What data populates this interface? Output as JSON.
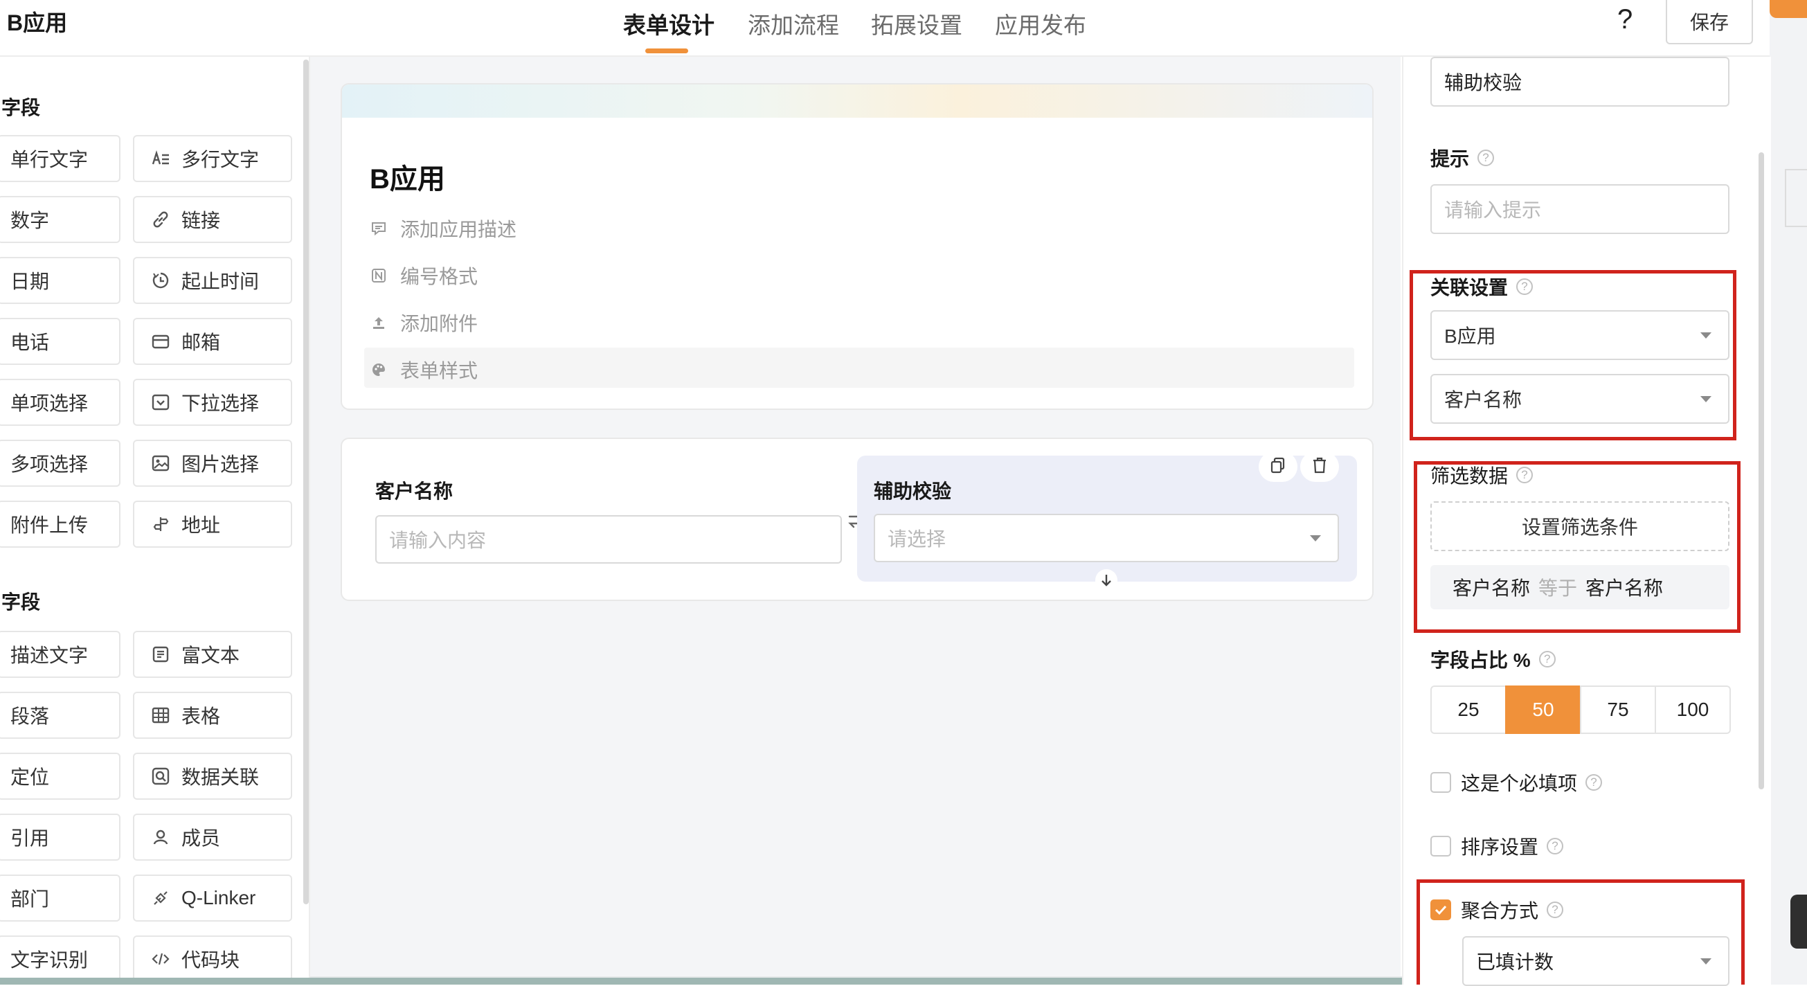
{
  "header": {
    "app_title": "B应用",
    "tabs": [
      {
        "label": "表单设计",
        "active": true
      },
      {
        "label": "添加流程",
        "active": false
      },
      {
        "label": "拓展设置",
        "active": false
      },
      {
        "label": "应用发布",
        "active": false
      }
    ],
    "help_label": "?",
    "save_label": "保存",
    "accent_color": "#f0913a"
  },
  "left_panel": {
    "section1_title": "字段",
    "section1_items": [
      {
        "label": "单行文字",
        "icon": null
      },
      {
        "label": "多行文字",
        "icon": "multiline-text-icon"
      },
      {
        "label": "数字",
        "icon": null
      },
      {
        "label": "链接",
        "icon": "link-icon"
      },
      {
        "label": "日期",
        "icon": null
      },
      {
        "label": "起止时间",
        "icon": "time-range-icon"
      },
      {
        "label": "电话",
        "icon": null
      },
      {
        "label": "邮箱",
        "icon": "mail-icon"
      },
      {
        "label": "单项选择",
        "icon": null
      },
      {
        "label": "下拉选择",
        "icon": "dropdown-icon"
      },
      {
        "label": "多项选择",
        "icon": null
      },
      {
        "label": "图片选择",
        "icon": "image-icon"
      },
      {
        "label": "附件上传",
        "icon": null
      },
      {
        "label": "地址",
        "icon": "map-pin-icon"
      }
    ],
    "section2_title": "字段",
    "section2_items": [
      {
        "label": "描述文字",
        "icon": null
      },
      {
        "label": "富文本",
        "icon": "rich-text-icon"
      },
      {
        "label": "段落",
        "icon": null
      },
      {
        "label": "表格",
        "icon": "table-icon"
      },
      {
        "label": "定位",
        "icon": null
      },
      {
        "label": "数据关联",
        "icon": "data-link-icon"
      },
      {
        "label": "引用",
        "icon": null
      },
      {
        "label": "成员",
        "icon": "user-icon"
      },
      {
        "label": "部门",
        "icon": null
      },
      {
        "label": "Q-Linker",
        "icon": "plug-icon"
      },
      {
        "label": "文字识别",
        "icon": null
      },
      {
        "label": "代码块",
        "icon": "code-icon"
      }
    ]
  },
  "canvas": {
    "form_title": "B应用",
    "meta_items": [
      {
        "label": "添加应用描述",
        "icon": "comment-icon"
      },
      {
        "label": "编号格式",
        "icon": "number-format-icon"
      },
      {
        "label": "添加附件",
        "icon": "upload-icon"
      },
      {
        "label": "表单样式",
        "icon": "palette-icon"
      }
    ],
    "field_left": {
      "label": "客户名称",
      "placeholder": "请输入内容"
    },
    "field_right": {
      "label": "辅助校验",
      "placeholder": "请选择"
    }
  },
  "right_panel": {
    "title_value": "辅助校验",
    "hint_label": "提示",
    "hint_placeholder": "请输入提示",
    "relation_label": "关联设置",
    "relation_app": "B应用",
    "relation_field": "客户名称",
    "filter_label": "筛选数据",
    "filter_button": "设置筛选条件",
    "filter_rule": {
      "left": "客户名称",
      "op": "等于",
      "right": "客户名称"
    },
    "width_label": "字段占比 %",
    "width_options": [
      "25",
      "50",
      "75",
      "100"
    ],
    "width_selected": "50",
    "required_label": "这是个必填项",
    "required_checked": false,
    "sort_label": "排序设置",
    "sort_checked": false,
    "aggregate_label": "聚合方式",
    "aggregate_checked": true,
    "aggregate_value": "已填计数",
    "highlight_color": "#d0231c"
  }
}
